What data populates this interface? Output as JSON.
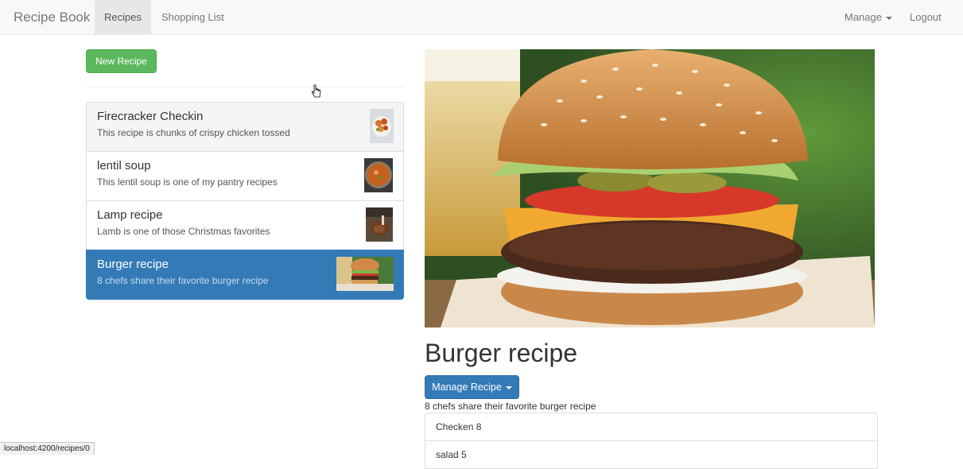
{
  "navbar": {
    "brand": "Recipe Book",
    "links": [
      "Recipes",
      "Shopping List"
    ],
    "manage_label": "Manage",
    "logout_label": "Logout"
  },
  "recipes_panel": {
    "new_button_label": "New Recipe",
    "items": [
      {
        "title": "Firecracker Checkin",
        "description": "This recipe is chunks of crispy chicken tossed",
        "thumb_icon": "chicken-dish-thumbnail"
      },
      {
        "title": "lentil soup",
        "description": "This lentil soup is one of my pantry recipes",
        "thumb_icon": "soup-bowl-thumbnail"
      },
      {
        "title": "Lamp recipe",
        "description": "Lamb is one of those Christmas favorites",
        "thumb_icon": "lamb-dish-thumbnail"
      },
      {
        "title": "Burger recipe",
        "description": "8 chefs share their favorite burger recipe",
        "thumb_icon": "burger-thumbnail",
        "selected": true
      }
    ]
  },
  "detail": {
    "title": "Burger recipe",
    "manage_button_label": "Manage Recipe",
    "description": "8 chefs share their favorite burger recipe",
    "ingredients": [
      "Checken 8",
      "salad 5"
    ]
  },
  "status_bar": {
    "url": "localhost:4200/recipes/0"
  },
  "colors": {
    "primary": "#337ab7",
    "success": "#5cb85c",
    "navbar_bg": "#f8f8f8"
  }
}
